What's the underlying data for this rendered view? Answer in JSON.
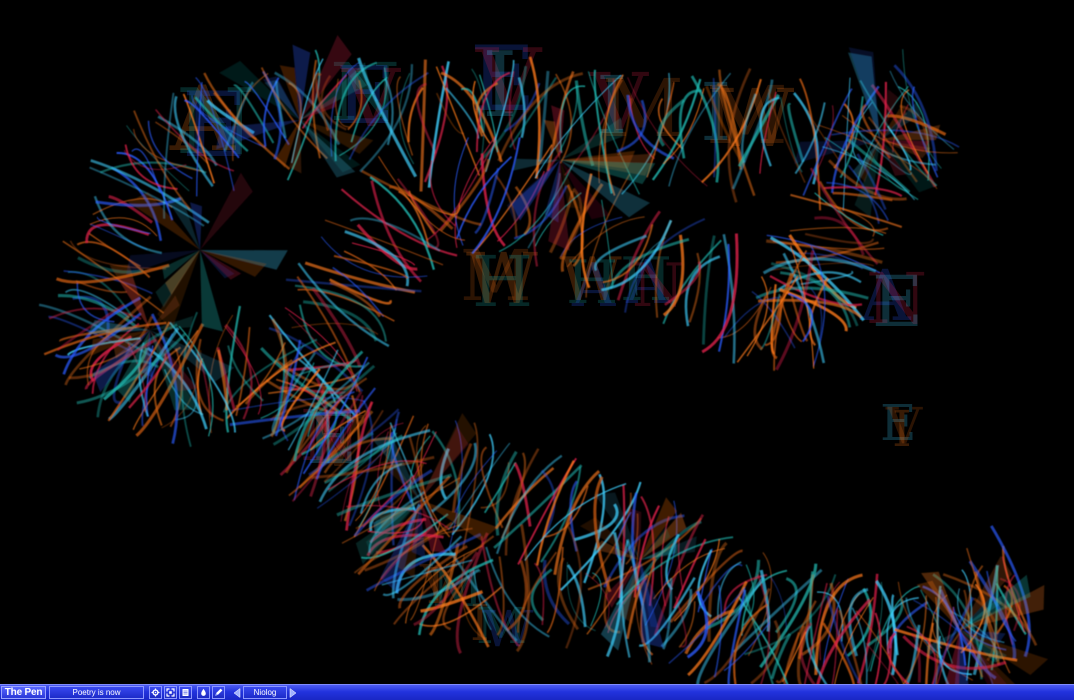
{
  "app": {
    "brand": "The Pen",
    "title": "Poetry is now",
    "nav_label": "Niolog"
  },
  "toolbar": {
    "buttons": [
      {
        "name": "settings-button",
        "icon": "gear-icon"
      },
      {
        "name": "fullscreen-button",
        "icon": "expand-icon"
      },
      {
        "name": "page-button",
        "icon": "page-icon"
      },
      {
        "name": "ink-button",
        "icon": "ink-drop-icon"
      },
      {
        "name": "pen-button",
        "icon": "pen-icon"
      }
    ],
    "nav_prev_icon": "arrow-left-icon",
    "nav_next_icon": "arrow-right-icon"
  },
  "canvas": {
    "background": "#000000",
    "palette": [
      "#ff7a1a",
      "#1fb8b0",
      "#2a5cff",
      "#e0204a",
      "#3fd0ff",
      "#c85a10"
    ],
    "glyphs": [
      "A",
      "N",
      "E",
      "V",
      "I",
      "M",
      "W",
      "H"
    ]
  },
  "colors": {
    "toolbar": "#2233dd",
    "toolbar_border": "#8d98ff",
    "toolbar_text": "#ffffff"
  }
}
